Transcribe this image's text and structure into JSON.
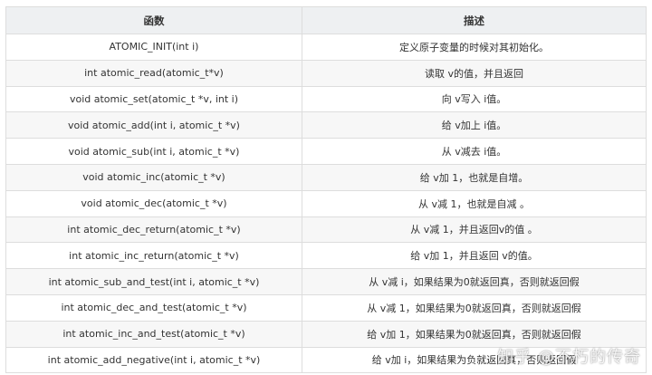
{
  "table": {
    "headers": [
      "函数",
      "描述"
    ],
    "rows": [
      [
        "ATOMIC_INIT(int i)",
        "定义原子变量的时候对其初始化。"
      ],
      [
        "int atomic_read(atomic_t*v)",
        "读取 v的值，并且返回"
      ],
      [
        "void atomic_set(atomic_t *v, int i)",
        "向 v写入 i值。"
      ],
      [
        "void atomic_add(int i, atomic_t *v)",
        "给 v加上 i值。"
      ],
      [
        "void atomic_sub(int i, atomic_t *v)",
        "从 v减去 i值。"
      ],
      [
        "void atomic_inc(atomic_t *v)",
        "给 v加 1，也就是自增。"
      ],
      [
        "void atomic_dec(atomic_t *v)",
        "从 v减 1，也就是自减 。"
      ],
      [
        "int atomic_dec_return(atomic_t *v)",
        "从 v减 1，并且返回v的值 。"
      ],
      [
        "int atomic_inc_return(atomic_t *v)",
        "给 v加 1，并且返回 v的值。"
      ],
      [
        "int atomic_sub_and_test(int i, atomic_t *v)",
        "从 v减 i，如果结果为0就返回真，否则就返回假"
      ],
      [
        "int atomic_dec_and_test(atomic_t *v)",
        "从 v减 1，如果结果为0就返回真，否则就返回假"
      ],
      [
        "int atomic_inc_and_test(atomic_t *v)",
        "给 v加 1，如果结果为0就返回真，否则就返回假"
      ],
      [
        "int atomic_add_negative(int i, atomic_t *v)",
        "给 v加 i，如果结果为负就返回真，否则返回假"
      ]
    ]
  },
  "watermark": "知乎 @不朽的传奇"
}
